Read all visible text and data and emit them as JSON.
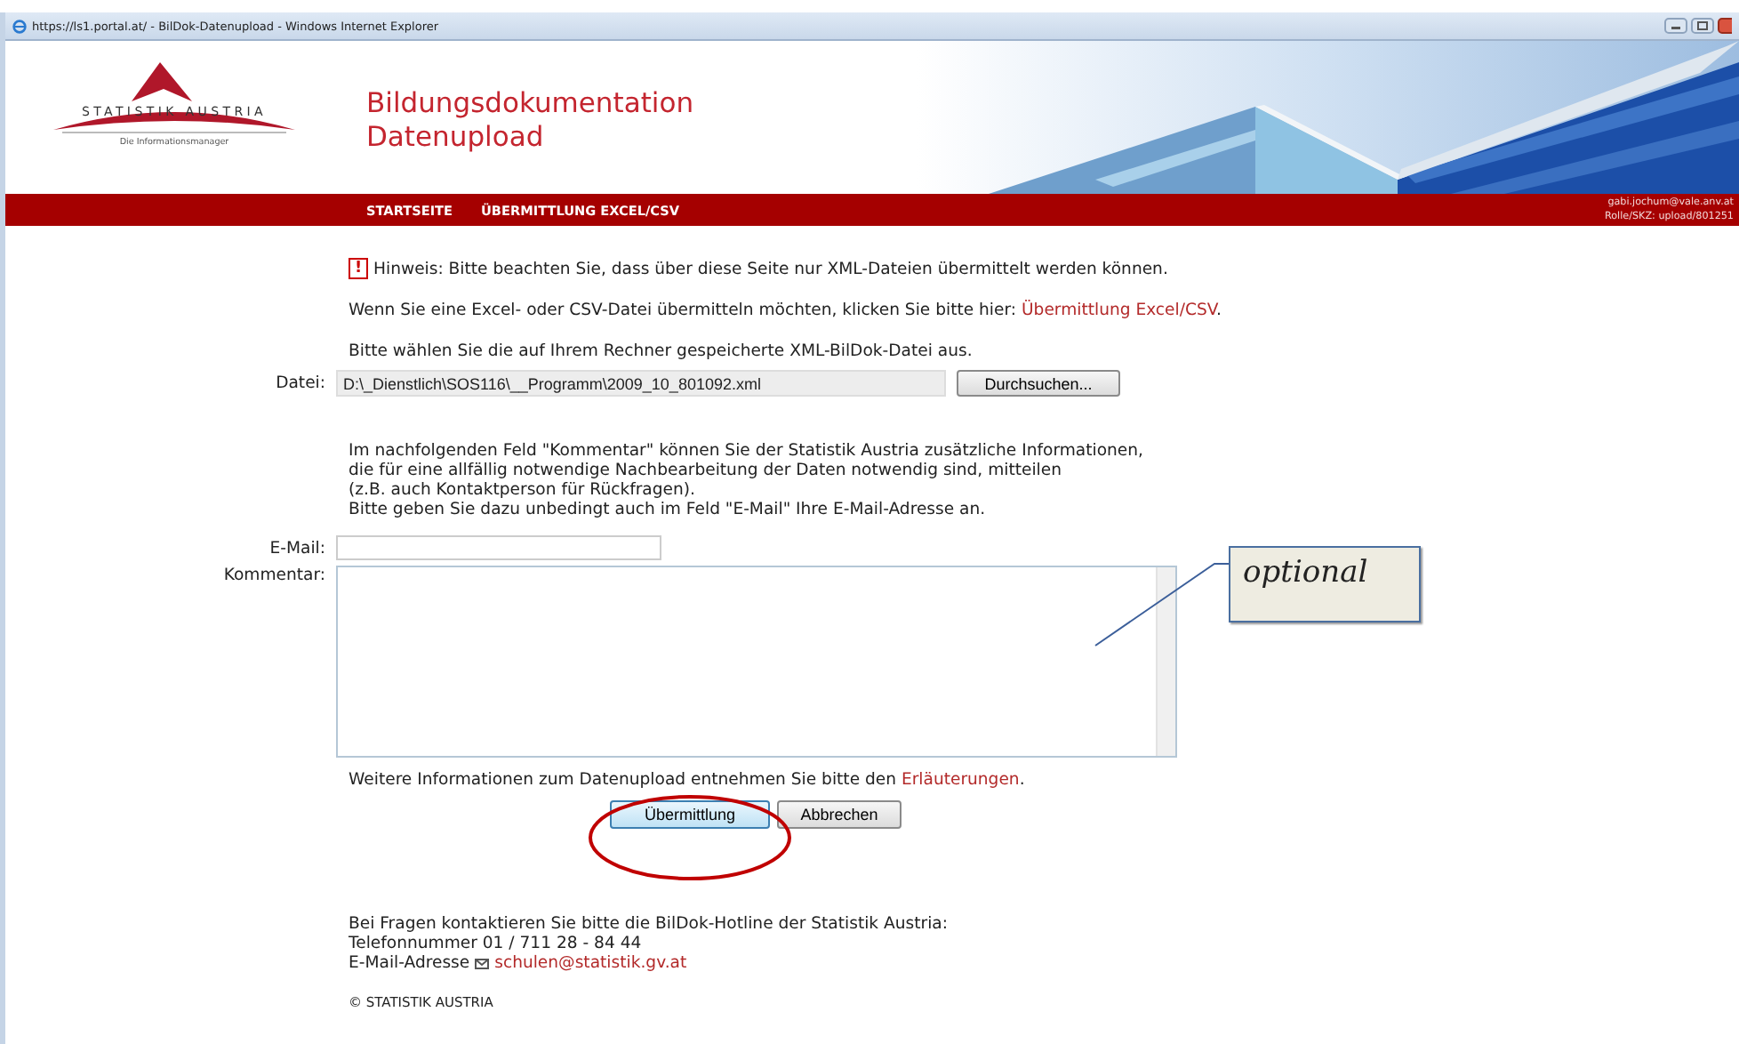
{
  "window": {
    "title": "https://ls1.portal.at/ - BilDok-Datenupload - Windows Internet Explorer"
  },
  "header": {
    "logo_name": "STATISTIK AUSTRIA",
    "logo_tagline": "Die Informationsmanager",
    "title_lines": [
      "Bildungsdokumentation",
      "Datenupload"
    ]
  },
  "nav": {
    "items": [
      {
        "label": "STARTSEITE"
      },
      {
        "label": "ÜBERMITTLUNG EXCEL/CSV"
      }
    ],
    "user_lines": [
      "gabi.jochum@vale.anv.at",
      "Rolle/SKZ: upload/801251"
    ]
  },
  "notice": {
    "icon": "!",
    "text": "Hinweis: Bitte beachten Sie, dass über diese Seite nur XML-Dateien übermittelt werden können."
  },
  "excel_hint": {
    "text": "Wenn Sie eine Excel- oder CSV-Datei übermitteln möchten, klicken Sie bitte hier: ",
    "link": "Übermittlung Excel/CSV",
    "end": "."
  },
  "choose_hint": "Bitte wählen Sie die auf Ihrem Rechner gespeicherte XML-BilDok-Datei aus.",
  "file": {
    "label": "Datei:",
    "value": "D:\\_Dienstlich\\SOS116\\__Programm\\2009_10_801092.xml",
    "button": "Durchsuchen..."
  },
  "comment_info": [
    "Im nachfolgenden Feld \"Kommentar\" können Sie der Statistik Austria zusätzliche Informationen,",
    "die für eine allfällig notwendige Nachbearbeitung der Daten notwendig sind, mitteilen",
    "(z.B. auch Kontaktperson für Rückfragen).",
    "Bitte geben Sie dazu unbedingt auch im Feld \"E-Mail\" Ihre E-Mail-Adresse an."
  ],
  "email": {
    "label": "E-Mail:"
  },
  "comment": {
    "label": "Kommentar:"
  },
  "more_info": {
    "text": "Weitere Informationen zum Datenupload entnehmen Sie bitte den ",
    "link": "Erläuterungen",
    "end": "."
  },
  "buttons": [
    {
      "label": "Übermittlung",
      "focused": true
    },
    {
      "label": "Abbrechen",
      "focused": false
    }
  ],
  "footer": {
    "lines": [
      "Bei Fragen kontaktieren Sie bitte die BilDok-Hotline der Statistik Austria:",
      "Telefonnummer 01 / 711 28 - 84 44"
    ],
    "email_label": "E-Mail-Adresse",
    "email_link": "schulen@statistik.gv.at",
    "copyright": "© STATISTIK AUSTRIA"
  },
  "annotation": {
    "text": "optional"
  }
}
